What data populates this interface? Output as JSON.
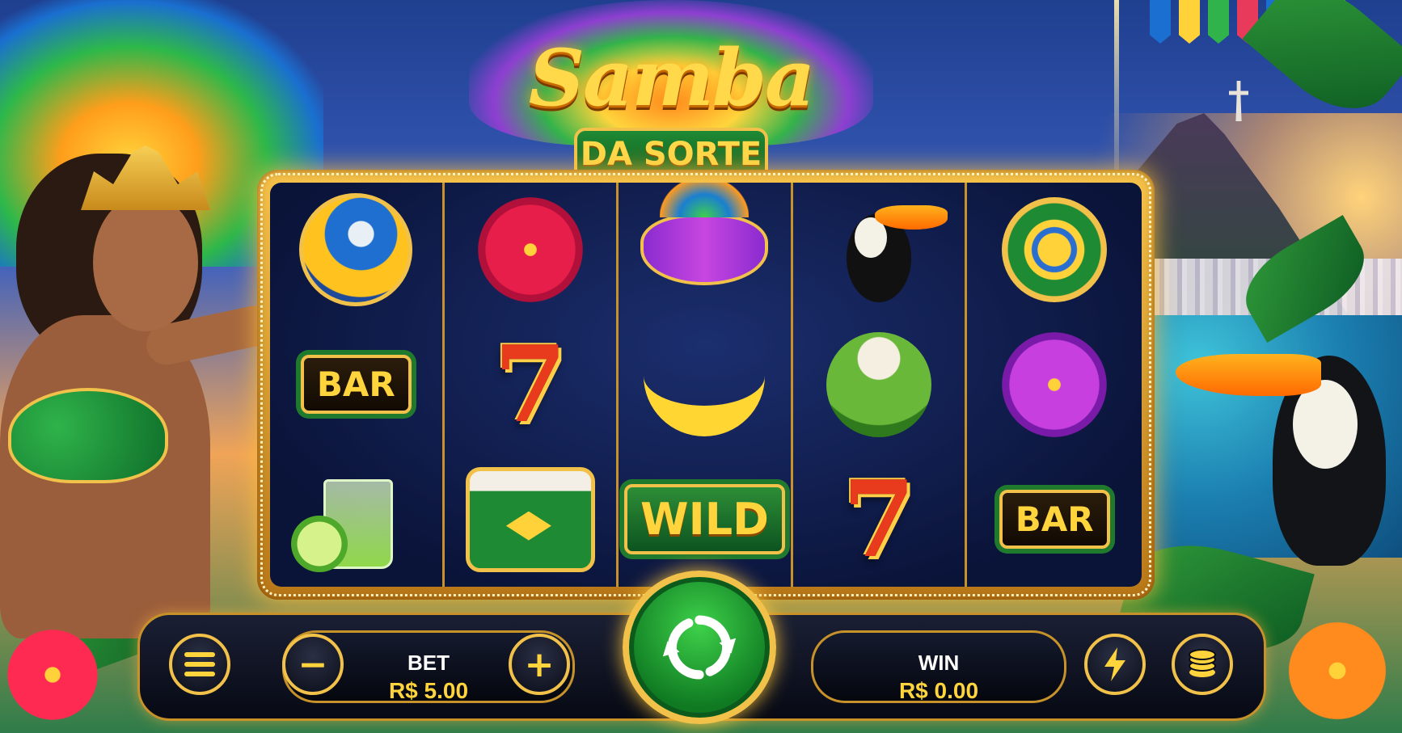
{
  "game": {
    "title": "Samba",
    "subtitle": "DA SORTE"
  },
  "reels": [
    [
      "parrot-icon",
      "bar-symbol",
      "caipirinha-icon"
    ],
    [
      "hibiscus-red-icon",
      "seven-symbol",
      "drum-icon"
    ],
    [
      "carnival-mask-icon",
      "banana-icon",
      "wild-symbol"
    ],
    [
      "toucan-icon",
      "coconut-drink-icon",
      "seven-symbol"
    ],
    [
      "brazil-coin-icon",
      "hibiscus-purple-icon",
      "bar-symbol"
    ]
  ],
  "symbols": {
    "bar": "BAR",
    "wild": "WILD",
    "seven": "7"
  },
  "controls": {
    "menu_icon": "menu-icon",
    "bet": {
      "label": "BET",
      "value": "R$ 5.00",
      "decrease": "−",
      "increase": "+"
    },
    "spin_icon": "spin-icon",
    "win": {
      "label": "WIN",
      "value": "R$ 0.00"
    },
    "turbo_icon": "lightning-icon",
    "coins_icon": "coins-icon"
  },
  "colors": {
    "gold": "#f2c14a",
    "text_gold": "#ffd43c",
    "spin_green": "#1fa535",
    "panel_dark": "#0a0d18"
  }
}
